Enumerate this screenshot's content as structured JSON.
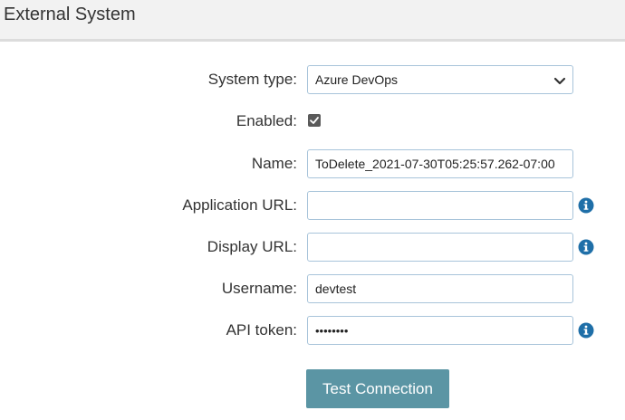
{
  "header": {
    "title": "External System"
  },
  "form": {
    "system_type": {
      "label": "System type:",
      "value": "Azure DevOps"
    },
    "enabled": {
      "label": "Enabled:",
      "checked": true
    },
    "name": {
      "label": "Name:",
      "value": "ToDelete_2021-07-30T05:25:57.262-07:00"
    },
    "application_url": {
      "label": "Application URL:",
      "value": ""
    },
    "display_url": {
      "label": "Display URL:",
      "value": ""
    },
    "username": {
      "label": "Username:",
      "value": "devtest"
    },
    "api_token": {
      "label": "API token:",
      "value": "••••••••"
    }
  },
  "actions": {
    "test_connection_label": "Test Connection"
  },
  "colors": {
    "button_bg": "#5b95a4",
    "info_icon": "#1f6fa8",
    "field_border": "#a8c4da",
    "header_bg": "#f2f2f2"
  },
  "icons": {
    "info": "info-circle-icon",
    "chevron": "chevron-down-icon",
    "check": "check-icon"
  }
}
